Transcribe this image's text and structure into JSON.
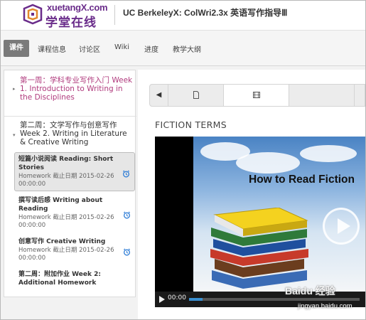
{
  "header": {
    "logo_latin": "xuetangX.com",
    "logo_cn": "学堂在线",
    "course_title": "UC BerkeleyX: ColWri2.3x 英语写作指导Ⅲ",
    "accent": "#6a2c8a"
  },
  "nav": {
    "items": [
      {
        "label": "课件",
        "active": true
      },
      {
        "label": "课程信息"
      },
      {
        "label": "讨论区"
      },
      {
        "label": "Wiki"
      },
      {
        "label": "进度"
      },
      {
        "label": "教学大纲"
      }
    ]
  },
  "sidebar": {
    "chapters": [
      {
        "title": "第一周：学科专业写作入门 Week 1. Introduction to Writing in the Disciplines",
        "color": "#b03a7d"
      },
      {
        "title": "第二周：文学写作与创意写作 Week 2. Writing in Literature & Creative Writing",
        "color": "#333333"
      }
    ],
    "sections": [
      {
        "title": "短篇小说阅读 Reading: Short Stories",
        "sub": "Homework 截止日期 2015-02-26 00:00:00",
        "icon": "alarm-clock-icon",
        "active": true
      },
      {
        "title": "撰写读后感 Writing about Reading",
        "sub": "Homework 截止日期 2015-02-26 00:00:00",
        "icon": "alarm-clock-icon"
      },
      {
        "title": "创意写作 Creative Writing",
        "sub": "Homework 截止日期 2015-02-26 00:00:00",
        "icon": "alarm-clock-icon"
      },
      {
        "title": "第二周：附加作业 Week 2: Additional Homework",
        "sub": ""
      }
    ]
  },
  "content": {
    "heading": "FICTION TERMS",
    "sequence_nav": {
      "prev_icon": "left-arrow-icon",
      "tabs": [
        "document-icon",
        "video-icon",
        "blank"
      ]
    },
    "video": {
      "title": "How to Read Fiction",
      "time": "00:00",
      "play_icon": "play-icon"
    }
  },
  "watermark": {
    "brand": "Baidu 经验",
    "url": "jingyan.baidu.com"
  }
}
